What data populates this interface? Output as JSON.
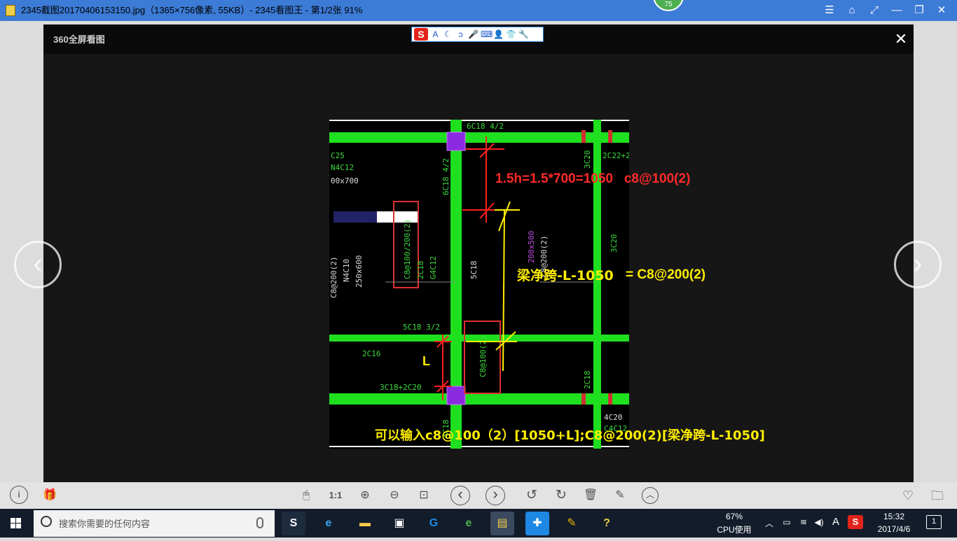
{
  "window": {
    "title": "2345截图20170406153150.jpg（1365×756像素, 55KB）- 2345看图王 - 第1/2张 91%",
    "badge": "75",
    "controls": [
      "☰",
      "⌂",
      "⤢",
      "—",
      "❐",
      "✕"
    ]
  },
  "viewer": {
    "brand": "360全屏看图",
    "close": "✕",
    "prev": "‹",
    "next": "›"
  },
  "ime": {
    "logo": "S",
    "items": [
      "A",
      "☾",
      "ɔ",
      "🎤",
      "⌨",
      "👤",
      "👕",
      "🔧"
    ]
  },
  "drawing": {
    "cad_labels": [
      "6C18 4/2",
      "3C20",
      "2C22+2",
      "C25",
      "N4C12",
      "00x700",
      "6C18 4/2",
      "C8@100/200(2)",
      "2C18",
      "G4C12",
      "5C18",
      "200x500",
      "C8@200(2)",
      "3C20",
      "C8@200(2)",
      "N4C10",
      "250x600",
      "5C18 3/2",
      "2C16",
      "C8@100(2)",
      "3C18+2C20",
      "2C18",
      "4C20",
      "C4C12",
      "4C18"
    ],
    "annotation_red": "1.5h=1.5*700=1050   c8@100(2)",
    "annotation_yellow_1": "梁净跨-L-1050",
    "annotation_yellow_2": "= C8@200(2)",
    "annotation_L": "L",
    "annotation_bottom": "可以输入c8@100（2）[1050+L];C8@200(2)[梁净跨-L-1050]"
  },
  "toolbar": {
    "info": "i",
    "gift": "🎁",
    "mouse": "🖱",
    "one_to_one": "1:1",
    "zoom_in": "⊕",
    "zoom_out": "⊖",
    "fit": "⊡",
    "prev": "‹",
    "next": "›",
    "rotate_left": "↺",
    "rotate_right": "↻",
    "delete": "🗑",
    "edit": "✎",
    "more": "︿",
    "favorite": "♡",
    "folder": "🗀"
  },
  "taskbar": {
    "search_placeholder": "搜索你需要的任何内容",
    "cpu_percent": "67%",
    "cpu_label": "CPU使用",
    "time": "15:32",
    "date": "2017/4/6",
    "notifications": "1"
  }
}
